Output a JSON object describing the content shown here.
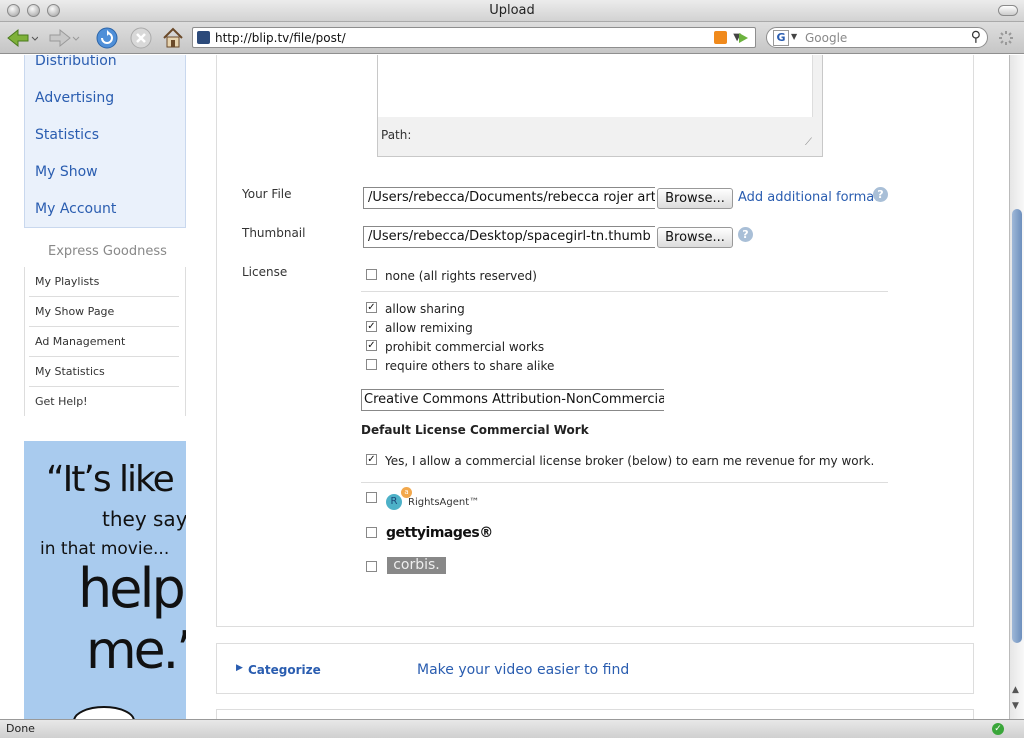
{
  "window": {
    "title": "Upload"
  },
  "toolbar": {
    "url": "http://blip.tv/file/post/",
    "search_placeholder": "Google",
    "search_engine_icon": "google-g-icon"
  },
  "sidebar": {
    "nav": [
      "Distribution",
      "Advertising",
      "Statistics",
      "My Show",
      "My Account"
    ],
    "section_title": "Express Goodness",
    "subnav": [
      "My Playlists",
      "My Show Page",
      "Ad Management",
      "My Statistics",
      "Get Help!"
    ],
    "ad": {
      "line1": "“It’s like",
      "line2": "they say",
      "line3": "in that movie...",
      "line4": "help",
      "line5": "me.”"
    }
  },
  "form": {
    "description_path_label": "Path:",
    "your_file_label": "Your File",
    "your_file_value": "/Users/rebecca/Documents/rebecca rojer artv",
    "browse_label": "Browse...",
    "add_format_link": "Add additional format",
    "thumbnail_label": "Thumbnail",
    "thumbnail_value": "/Users/rebecca/Desktop/spacegirl-tn.thumb",
    "license_label": "License",
    "license_options": [
      {
        "label": "none (all rights reserved)",
        "checked": false
      },
      {
        "label": "allow sharing",
        "checked": true
      },
      {
        "label": "allow remixing",
        "checked": true
      },
      {
        "label": "prohibit commercial works",
        "checked": true
      },
      {
        "label": "require others to share alike",
        "checked": false
      }
    ],
    "license_result": "Creative Commons Attribution-NonCommercial",
    "default_commercial_heading": "Default License Commercial Work",
    "broker_option": {
      "label": "Yes, I allow a commercial license broker (below) to earn me revenue for my work.",
      "checked": true
    },
    "brokers": [
      {
        "name": "RightsAgent™",
        "checked": false
      },
      {
        "name": "gettyimages®",
        "checked": false
      },
      {
        "name": "corbis.",
        "checked": false
      }
    ]
  },
  "categorize": {
    "label": "Categorize",
    "description": "Make your video easier to find"
  },
  "status": {
    "text": "Done"
  }
}
